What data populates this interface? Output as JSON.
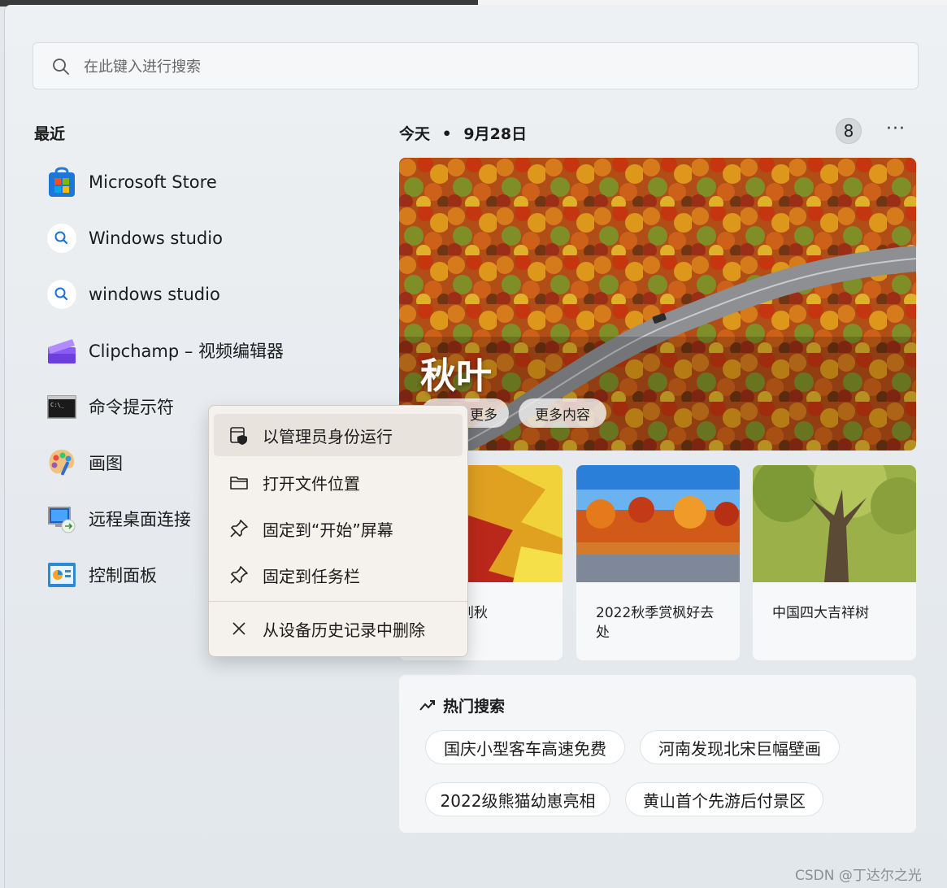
{
  "search": {
    "placeholder": "在此键入进行搜索"
  },
  "recent": {
    "title": "最近",
    "items": [
      {
        "label": "Microsoft Store",
        "icon": "microsoft-store-icon"
      },
      {
        "label": "Windows studio",
        "icon": "search-web-icon"
      },
      {
        "label": "windows studio",
        "icon": "search-web-icon"
      },
      {
        "label": "Clipchamp – 视频编辑器",
        "icon": "clipchamp-icon"
      },
      {
        "label": "命令提示符",
        "icon": "command-prompt-icon"
      },
      {
        "label": "画图",
        "icon": "paint-icon"
      },
      {
        "label": "远程桌面连接",
        "icon": "remote-desktop-icon"
      },
      {
        "label": "控制面板",
        "icon": "control-panel-icon"
      }
    ]
  },
  "today": {
    "label": "今天",
    "date": "9月28日",
    "badge": "8",
    "more": "···"
  },
  "hero": {
    "title": "秋叶",
    "chip_partial": "更多",
    "chip_more": "更多内容"
  },
  "cards": [
    {
      "caption": "什么一到秋\n色?"
    },
    {
      "caption": "2022秋季赏枫好去处"
    },
    {
      "caption": "中国四大吉祥树"
    }
  ],
  "trending": {
    "title": "热门搜索",
    "pills": [
      "国庆小型客车高速免费",
      "河南发现北宋巨幅壁画",
      "2022级熊猫幼崽亮相",
      "黄山首个先游后付景区"
    ]
  },
  "context_menu": {
    "items": [
      {
        "label": "以管理员身份运行",
        "icon": "shield-icon"
      },
      {
        "label": "打开文件位置",
        "icon": "folder-icon"
      },
      {
        "label": "固定到“开始”屏幕",
        "icon": "pin-icon"
      },
      {
        "label": "固定到任务栏",
        "icon": "pin-icon"
      },
      {
        "label": "从设备历史记录中删除",
        "icon": "close-icon"
      }
    ]
  },
  "watermark": "CSDN @丁达尔之光"
}
